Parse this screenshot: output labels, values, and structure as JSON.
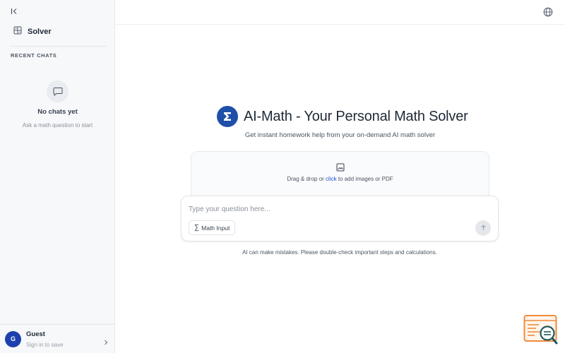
{
  "sidebar": {
    "nav": [
      {
        "label": "Solver",
        "icon": "calculator-icon"
      }
    ],
    "recent_heading": "RECENT CHATS",
    "empty_title": "No chats yet",
    "empty_subtitle": "Ask a math question to start",
    "user": {
      "initial": "G",
      "name": "Guest",
      "subtitle": "Sign in to save"
    }
  },
  "topbar": {
    "icons": [
      "globe-icon"
    ]
  },
  "main": {
    "title": "AI-Math - Your Personal Math Solver",
    "subtitle": "Get instant homework help from your on-demand AI math solver",
    "upload": {
      "text_before": "Drag & drop or ",
      "link": "click",
      "text_after": " to add images or PDF"
    },
    "composer": {
      "placeholder": "Type your question here...",
      "math_button_symbol": "∑",
      "math_button_label": "Math Input"
    },
    "disclaimer": "AI can make mistakes. Please double-check important steps and calculations."
  },
  "colors": {
    "brand": "#1f4fa8",
    "link": "#1d4ed8",
    "fab_orange": "#f08a3c",
    "fab_teal": "#1f5a5a"
  }
}
